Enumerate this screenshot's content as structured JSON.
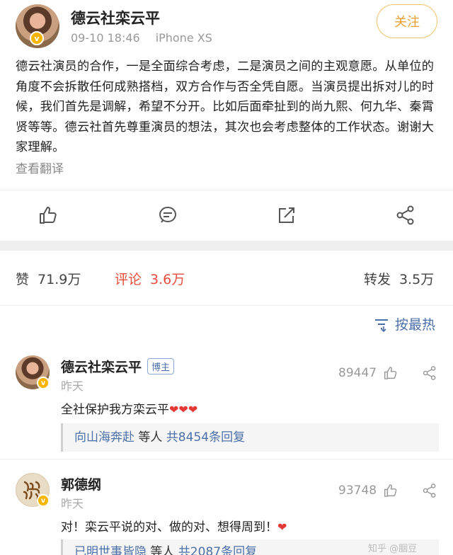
{
  "post": {
    "author": "德云社栾云平",
    "time": "09-10 18:46",
    "device": "iPhone XS",
    "follow_label": "关注",
    "verified_mark": "v",
    "text": "德云社演员的合作，一是全面综合考虑，二是演员之间的主观意愿。从单位的角度不会拆散任何成熟搭档，双方合作与否全凭自愿。当演员提出拆对儿的时候，我们首先是调解，希望不分开。比如后面牵扯到的尚九熙、何九华、秦霄贤等等。德云社首先尊重演员的想法，其次也会考虑整体的工作状态。谢谢大家理解。",
    "translate_label": "查看翻译",
    "actions": [
      "like-icon",
      "comment-icon",
      "repost-icon",
      "share-icon"
    ]
  },
  "stats": {
    "likes_label": "赞",
    "likes_value": "71.9万",
    "comments_label": "评论",
    "comments_value": "3.6万",
    "reposts_label": "转发",
    "reposts_value": "3.5万"
  },
  "sort": {
    "icon": "sort-icon",
    "label": "按最热"
  },
  "comments": [
    {
      "name": "德云社栾云平",
      "badge": "博主",
      "time": "昨天",
      "likes": "89447",
      "text": "全社保护我方栾云平",
      "hearts": "❤❤❤",
      "reply_user": "向山海奔赴",
      "reply_mid": " 等人 ",
      "reply_count": "共8454条回复"
    },
    {
      "name": "郭德纲",
      "time": "昨天",
      "likes": "93748",
      "text": "对！栾云平说的对、做的对、想得周到！",
      "hearts": "❤",
      "reply_user": "已明世事皆隐",
      "reply_mid": " 等人 ",
      "reply_count": "共2087条回复"
    }
  ],
  "watermark": "知乎 @胭豆",
  "colors": {
    "accent_orange": "#e8a02c",
    "link_blue": "#4b6fa8",
    "active_red": "#e74c3c",
    "verified_gold": "#f7b500"
  }
}
